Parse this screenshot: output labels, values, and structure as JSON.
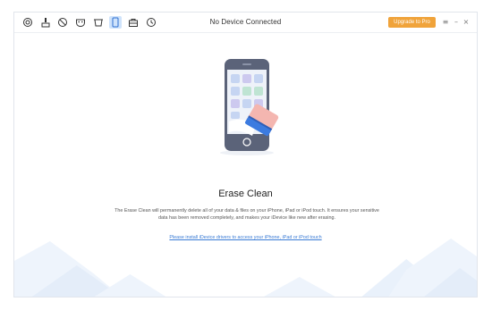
{
  "window": {
    "title": "No Device Connected",
    "upgrade_label": "Upgrade to Pro",
    "menu_glyph": "≡",
    "minimize_glyph": "–",
    "close_glyph": "×"
  },
  "toolbar": {
    "tools": [
      {
        "icon": "device-manager-icon"
      },
      {
        "icon": "cleaner-brush-icon"
      },
      {
        "icon": "block-icon"
      },
      {
        "icon": "privacy-mask-icon"
      },
      {
        "icon": "eraser-icon"
      },
      {
        "icon": "phone-icon",
        "active": true
      },
      {
        "icon": "toolbox-icon"
      },
      {
        "icon": "history-icon"
      }
    ]
  },
  "main": {
    "heading": "Erase Clean",
    "description_line1": "The Erase Clean will permanently delete all of your data & files on your iPhone, iPad or iPod touch. It ensures your sensitive",
    "description_line2": "data has been removed completely, and makes your iDevice like new after erasing.",
    "link_text": "Please install iDevice drivers to access your iPhone, iPad or iPod touch"
  },
  "colors": {
    "accent": "#f0a33a",
    "link": "#3a7bd5",
    "phone_body": "#5b6379",
    "eraser": "#f4b6b0"
  }
}
